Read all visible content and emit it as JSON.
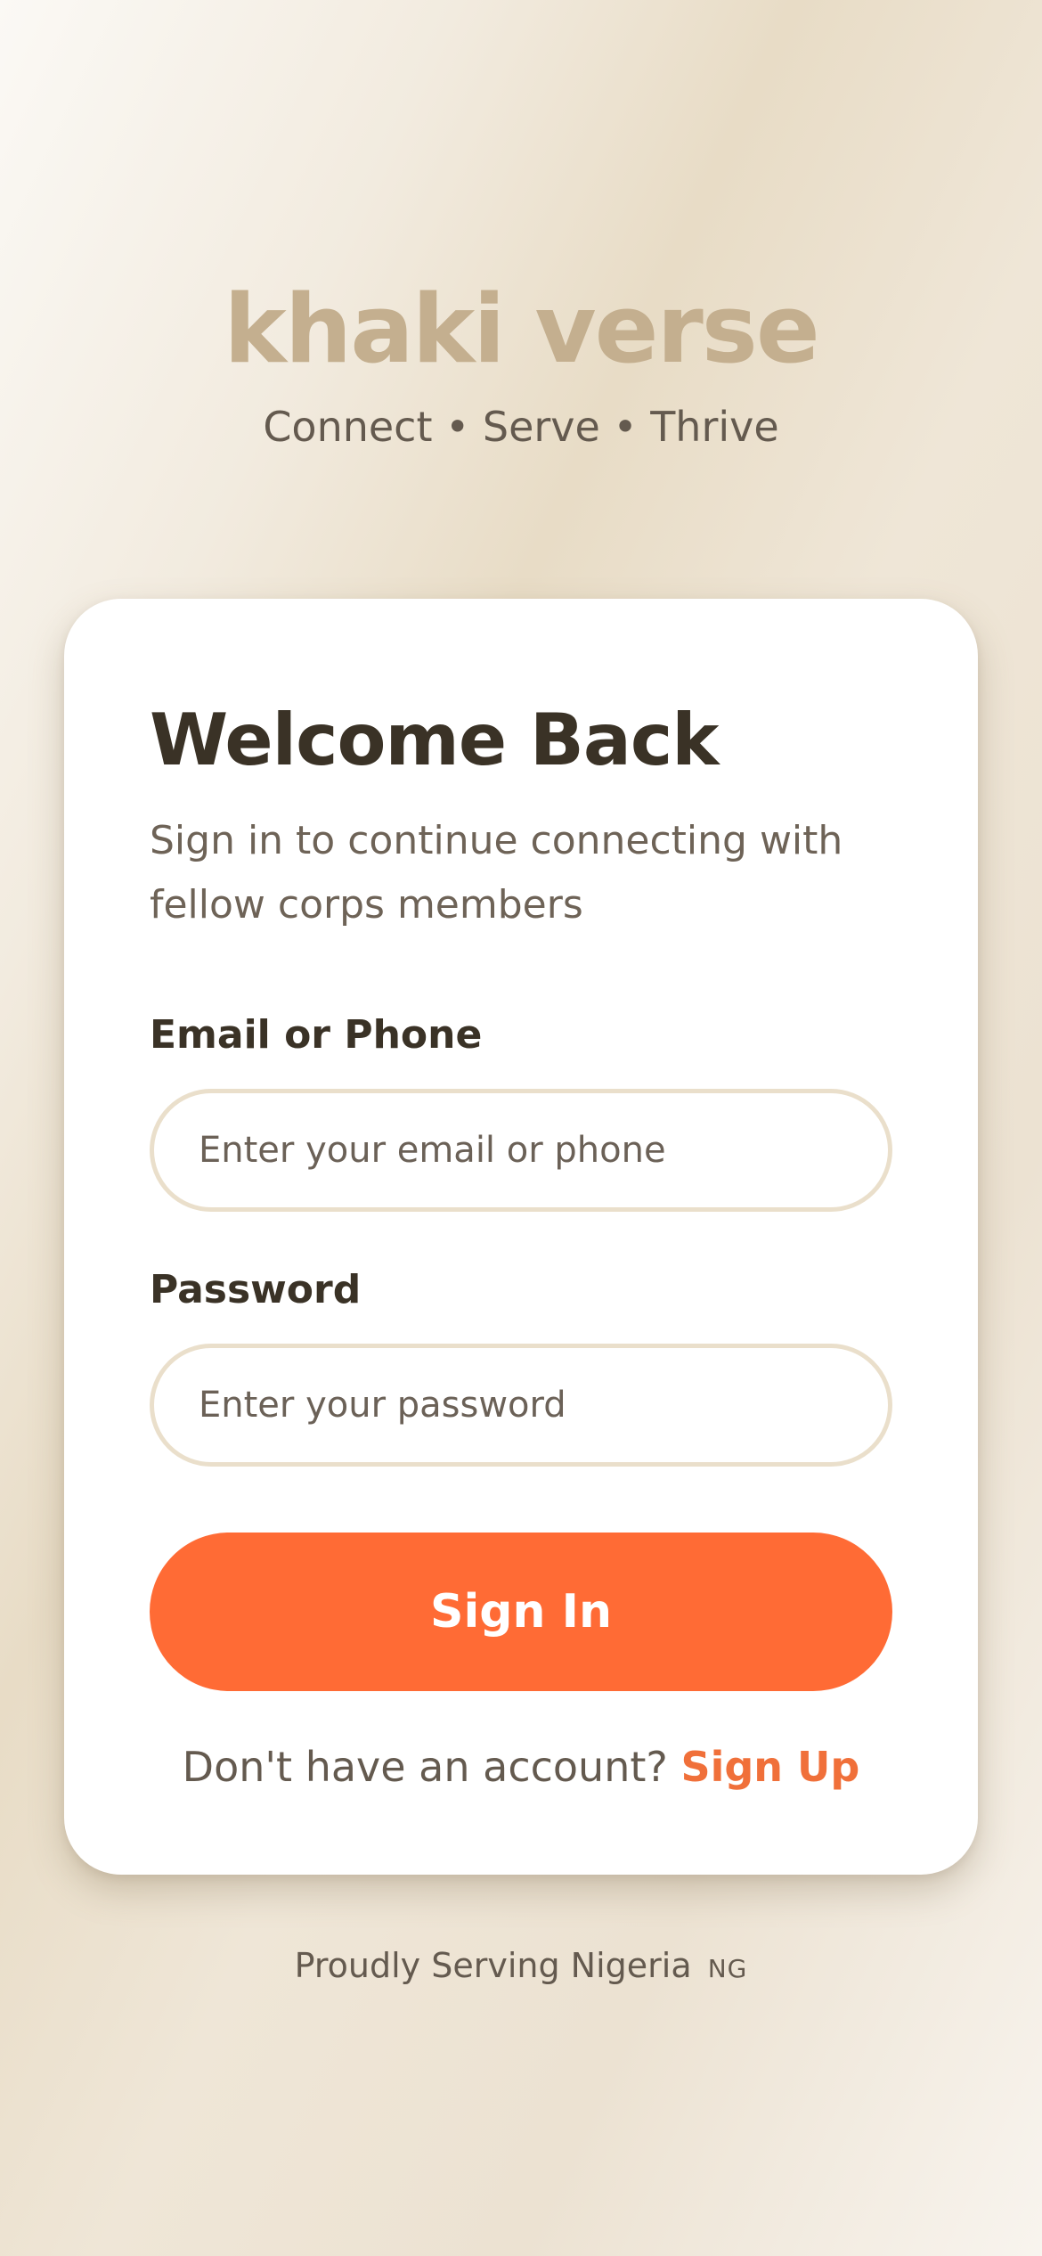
{
  "brand": {
    "title": "khaki verse",
    "tagline": "Connect • Serve • Thrive"
  },
  "login": {
    "title": "Welcome Back",
    "subtitle": "Sign in to continue connecting with fellow corps members",
    "email_label": "Email or Phone",
    "email_placeholder": "Enter your email or phone",
    "email_value": "",
    "password_label": "Password",
    "password_placeholder": "Enter your password",
    "password_value": "",
    "submit_label": "Sign In",
    "signup_prompt": "Don't have an account? ",
    "signup_link": "Sign Up"
  },
  "footer": {
    "text": "Proudly Serving Nigeria",
    "flag": "NG"
  },
  "colors": {
    "brand_title": "#c4af8f",
    "accent": "#ff6b35",
    "text_dark": "#3a3226",
    "text_muted": "#645a4f",
    "input_border": "#eadfcb"
  }
}
